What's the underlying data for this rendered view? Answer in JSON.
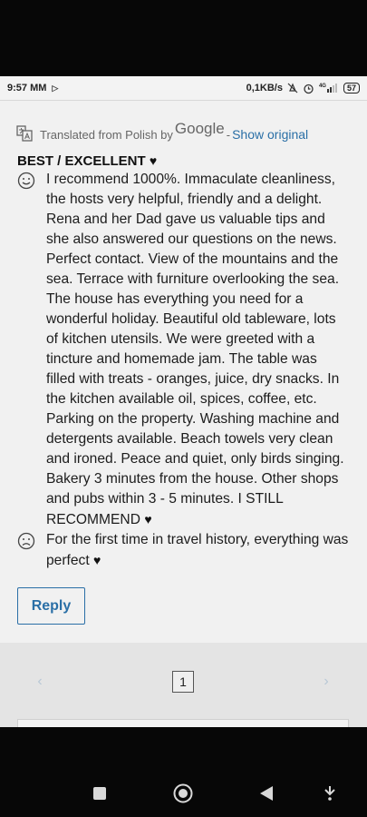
{
  "status_bar": {
    "time": "9:57 MM",
    "network_speed": "0,1KB/s",
    "network_type": "4G",
    "battery": "57",
    "icons": [
      "play-icon",
      "mute-icon",
      "alarm-icon",
      "signal-icon",
      "battery-icon"
    ]
  },
  "translation": {
    "prefix": "Translated from Polish by",
    "provider": "Google",
    "separator": "-",
    "show_original": "Show original"
  },
  "review": {
    "title": "BEST / EXCELLENT",
    "positive_text": "I recommend 1000%. Immaculate cleanliness, the hosts very helpful, friendly and a delight. Rena and her Dad gave us valuable tips and she also answered our questions on the news. Perfect contact. View of the mountains and the sea. Terrace with furniture overlooking the sea. The house has everything you need for a wonderful holiday. Beautiful old tableware, lots of kitchen utensils. We were greeted with a tincture and homemade jam. The table was filled with treats - oranges, juice, dry snacks. In the kitchen available oil, spices, coffee, etc. Parking on the property. Washing machine and detergents available. Beach towels very clean and ironed. Peace and quiet, only birds singing. Bakery 3 minutes from the house. Other shops and pubs within 3 - 5 minutes. I STILL RECOMMEND",
    "negative_text": "For the first time in travel history, everything was perfect"
  },
  "actions": {
    "reply_label": "Reply"
  },
  "pagination": {
    "prev": "‹",
    "current_page": "1",
    "next": "›"
  },
  "nav": {
    "items": [
      "recent-apps",
      "home",
      "back",
      "assistant"
    ]
  }
}
